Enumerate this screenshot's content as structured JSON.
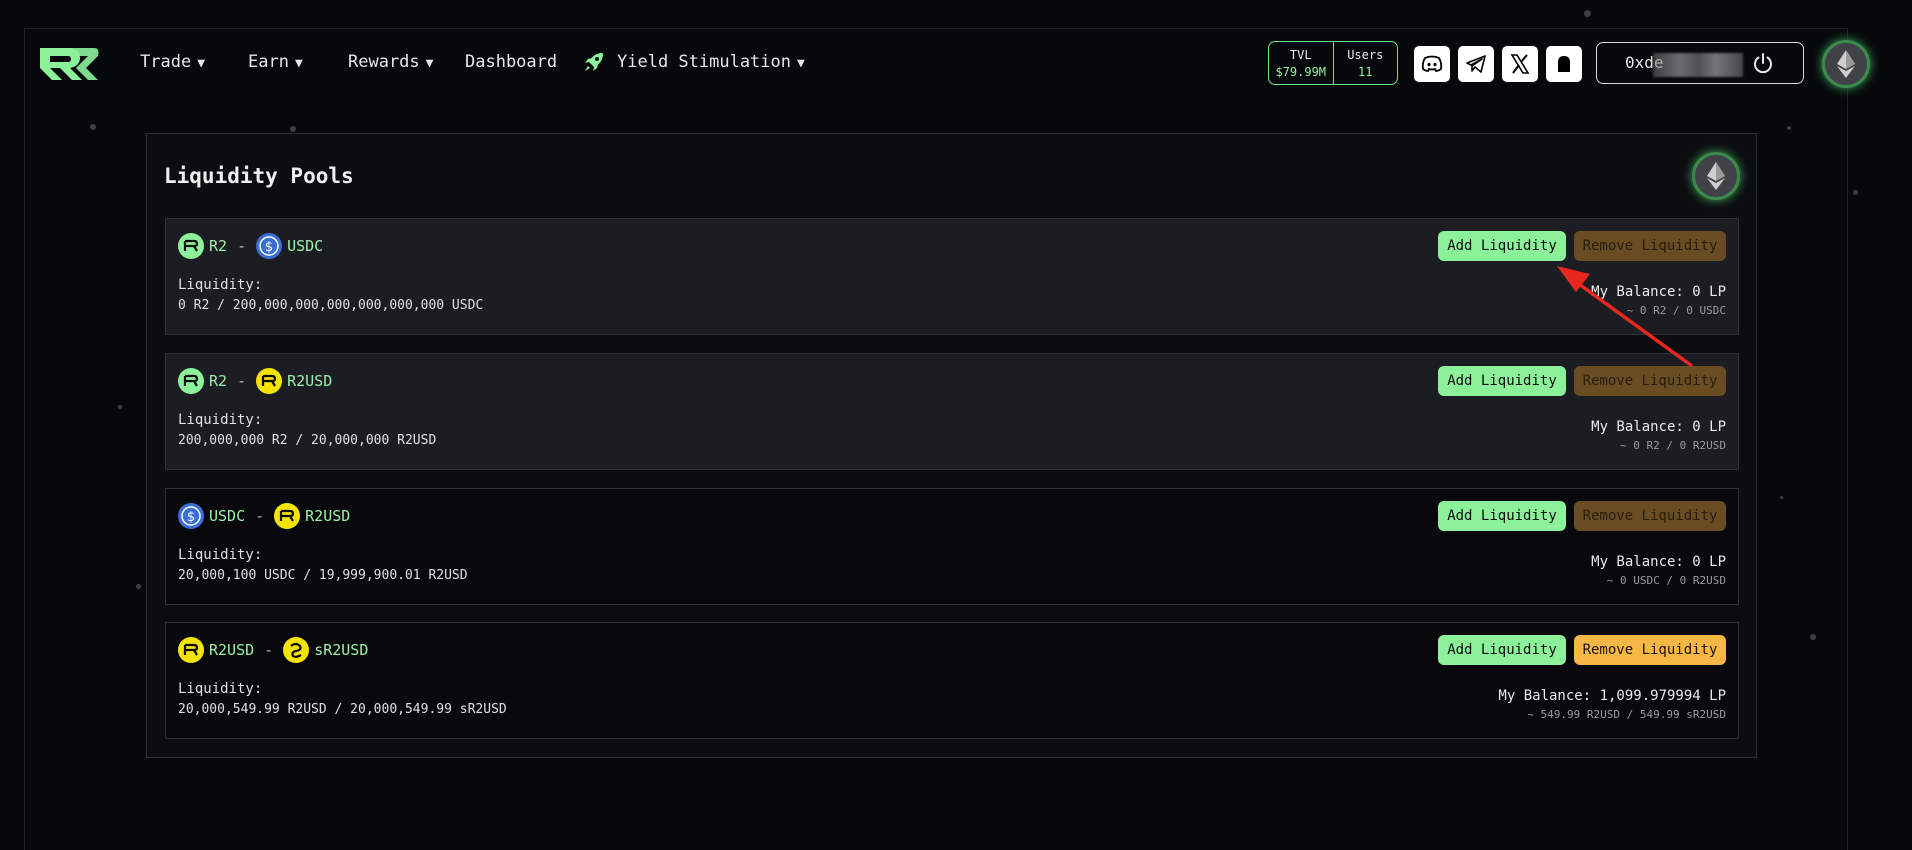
{
  "nav": {
    "items": [
      {
        "label": "Trade",
        "caret": "▼"
      },
      {
        "label": "Earn",
        "caret": "▼"
      },
      {
        "label": "Rewards",
        "caret": "▼"
      },
      {
        "label": "Dashboard",
        "caret": ""
      },
      {
        "label": "Yield Stimulation",
        "caret": "▼"
      }
    ],
    "stats": {
      "tvl_label": "TVL",
      "tvl_value": "$79.99M",
      "users_label": "Users",
      "users_value": "11"
    },
    "social_icons": [
      "discord-icon",
      "telegram-icon",
      "x-icon",
      "ghost-icon"
    ],
    "wallet_label": "0xde",
    "network_icon": "ethereum-icon"
  },
  "main": {
    "title": "Liquidity Pools",
    "add_label": "Add Liquidity",
    "remove_label": "Remove Liquidity",
    "liquidity_label": "Liquidity:",
    "pools": [
      {
        "token_a": "R2",
        "token_b": "USDC",
        "liquidity": "0 R2 / 200,000,000,000,000,000,000 USDC",
        "balance": "My Balance: 0 LP",
        "balance_sub": "~ 0 R2 / 0 USDC"
      },
      {
        "token_a": "R2",
        "token_b": "R2USD",
        "liquidity": "200,000,000 R2 / 20,000,000 R2USD",
        "balance": "My Balance: 0 LP",
        "balance_sub": "~ 0 R2 / 0 R2USD"
      },
      {
        "token_a": "USDC",
        "token_b": "R2USD",
        "liquidity": "20,000,100 USDC / 19,999,900.01 R2USD",
        "balance": "My Balance: 0 LP",
        "balance_sub": "~ 0 USDC / 0 R2USD"
      },
      {
        "token_a": "R2USD",
        "token_b": "sR2USD",
        "liquidity": "20,000,549.99 R2USD / 20,000,549.99 sR2USD",
        "balance": "My Balance: 1,099.979994 LP",
        "balance_sub": "~ 549.99 R2USD / 549.99 sR2USD"
      }
    ]
  },
  "colors": {
    "accent_green": "#8cf29a",
    "remove_disabled": "#6a4c22",
    "remove_active": "#f7b744",
    "annotation_arrow": "#e8281e"
  }
}
